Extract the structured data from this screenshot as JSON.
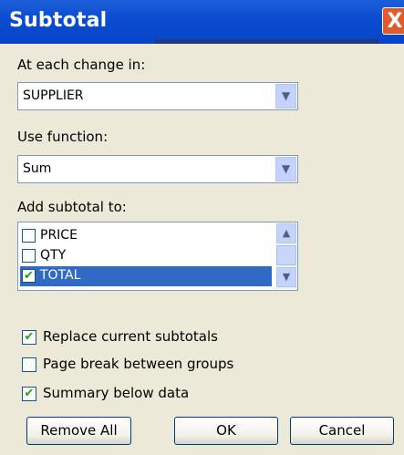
{
  "window": {
    "title": "Subtotal",
    "close_glyph": "X"
  },
  "change_in": {
    "label": "At each change in:",
    "value": "SUPPLIER"
  },
  "function": {
    "label": "Use function:",
    "value": "Sum"
  },
  "add_subtotal": {
    "label": "Add subtotal to:",
    "items": [
      {
        "label": "PRICE",
        "checked": false
      },
      {
        "label": "QTY",
        "checked": false
      },
      {
        "label": "TOTAL",
        "checked": true,
        "selected": true
      }
    ]
  },
  "options": {
    "replace": {
      "label": "Replace current subtotals",
      "checked": true
    },
    "page_break": {
      "label": "Page break between groups",
      "checked": false
    },
    "summary_below": {
      "label": "Summary below data",
      "checked": true
    }
  },
  "buttons": {
    "remove_all": "Remove All",
    "ok": "OK",
    "cancel": "Cancel"
  },
  "icons": {
    "dropdown": "chevron-down-icon",
    "check": "checkmark-icon"
  },
  "colors": {
    "titlebar": "#0a4bd0",
    "selection": "#316ac5",
    "check": "#21a121"
  }
}
